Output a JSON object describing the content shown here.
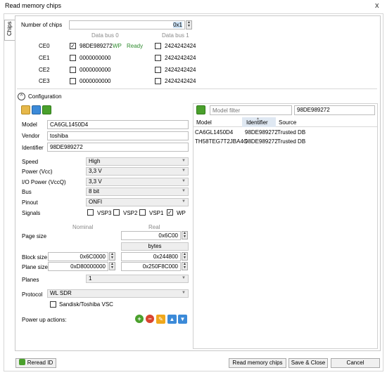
{
  "window": {
    "title": "Read memory chips",
    "close_glyph": "x"
  },
  "side_tab": {
    "label": "Chips"
  },
  "chips": {
    "count_label": "Number of chips",
    "count_value": "0x1",
    "bus0_label": "Data bus 0",
    "bus1_label": "Data bus 1",
    "rows": [
      {
        "ce": "CE0",
        "checked": true,
        "bus0": "98DE989272",
        "wp": "WP",
        "ready": "Ready",
        "bus1": "2424242424"
      },
      {
        "ce": "CE1",
        "checked": false,
        "bus0": "0000000000",
        "bus1": "2424242424"
      },
      {
        "ce": "CE2",
        "checked": false,
        "bus0": "0000000000",
        "bus1": "2424242424"
      },
      {
        "ce": "CE3",
        "checked": false,
        "bus0": "0000000000",
        "bus1": "2424242424"
      }
    ]
  },
  "configuration": {
    "label": "Configuration",
    "collapse_glyph": "^",
    "model_label": "Model",
    "model_value": "CA6GL1450D4",
    "vendor_label": "Vendor",
    "vendor_value": "toshiba",
    "identifier_label": "Identifier",
    "identifier_value": "98DE989272",
    "speed_label": "Speed",
    "speed_value": "High",
    "power_label": "Power (Vcc)",
    "power_value": "3,3 V",
    "io_power_label": "I/O Power (VccQ)",
    "io_power_value": "3,3 V",
    "bus_label": "Bus",
    "bus_value": "8 bit",
    "pinout_label": "Pinout",
    "pinout_value": "ONFI",
    "signals_label": "Signals",
    "signals": [
      {
        "name": "VSP3",
        "checked": false
      },
      {
        "name": "VSP2",
        "checked": false
      },
      {
        "name": "VSP1",
        "checked": false
      },
      {
        "name": "WP",
        "checked": true
      }
    ],
    "nominal_label": "Nominal",
    "real_label": "Real",
    "page_size_label": "Page size",
    "page_size_real": "0x6C00",
    "bytes_label": "bytes",
    "block_size_label": "Block size",
    "block_size_nominal": "0x6C0000",
    "block_size_real": "0x244800",
    "plane_size_label": "Plane size",
    "plane_size_nominal": "0xD80000000",
    "plane_size_real": "0x250F8C000",
    "planes_label": "Planes",
    "planes_value": "1",
    "protocol_label": "Protocol",
    "protocol_value": "WL SDR",
    "vsc_label": "Sandisk/Toshiba VSC",
    "power_up_label": "Power up actions:"
  },
  "filter": {
    "placeholder": "Model filter",
    "id_value": "98DE989272",
    "columns": [
      "Model",
      "Identifier",
      "Source"
    ],
    "rows": [
      [
        "CA6GL1450D4",
        "98DE989272",
        "Trusted DB"
      ],
      [
        "TH58TEG7T2JBA4C",
        "98DE989272",
        "Trusted DB"
      ]
    ]
  },
  "buttons": {
    "reread": "Reread ID",
    "read": "Read memory chips",
    "save_close": "Save & Close",
    "cancel": "Cancel"
  },
  "glyphs": {
    "check": "✓",
    "up": "▲",
    "down": "▼",
    "add": "+",
    "remove": "−",
    "edit": "✎"
  },
  "colors": {
    "green_text": "#2e8b2e",
    "accent_blue": "#3c8ad8",
    "green_icon": "#4aa02c",
    "red_icon": "#d9442f"
  }
}
